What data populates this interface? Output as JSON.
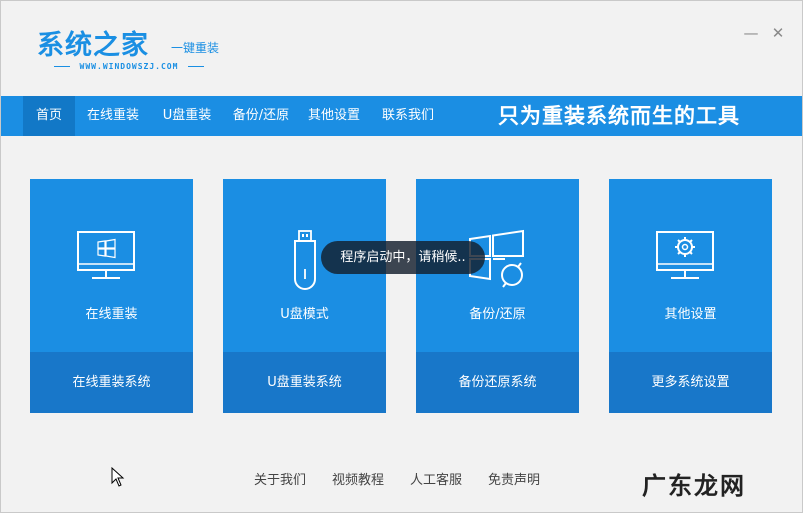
{
  "app": {
    "logo_title": "系统之家",
    "logo_subtitle": "一键重装",
    "logo_url": "WWW.WINDOWSZJ.COM",
    "minimize_label": "—",
    "close_label": "✕"
  },
  "nav": {
    "items": [
      {
        "label": "首页",
        "active": true
      },
      {
        "label": "在线重装"
      },
      {
        "label": "U盘重装"
      },
      {
        "label": "备份/还原"
      },
      {
        "label": "其他设置"
      },
      {
        "label": "联系我们"
      }
    ],
    "slogan": "只为重装系统而生的工具"
  },
  "cards": [
    {
      "icon": "windows-monitor-icon",
      "title": "在线重装",
      "action": "在线重装系统"
    },
    {
      "icon": "usb-drive-icon",
      "title": "U盘模式",
      "action": "U盘重装系统"
    },
    {
      "icon": "windows-restore-icon",
      "title": "备份/还原",
      "action": "备份还原系统"
    },
    {
      "icon": "settings-monitor-icon",
      "title": "其他设置",
      "action": "更多系统设置"
    }
  ],
  "toast": "程序启动中，请稍候..",
  "footer": {
    "links": [
      "关于我们",
      "视频教程",
      "人工客服",
      "免责声明"
    ]
  },
  "watermark": "广东龙网",
  "colors": {
    "primary": "#1b8ee3",
    "card_bottom": "#1877c9",
    "nav_active": "#1278c7",
    "background": "#f2f2f2"
  }
}
